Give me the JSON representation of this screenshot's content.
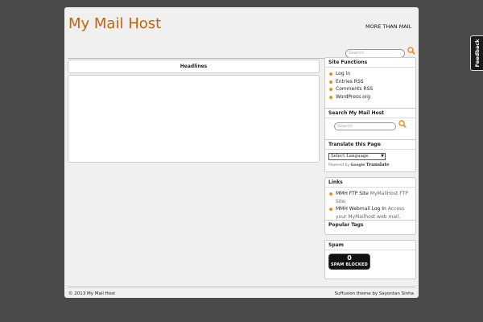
{
  "site": {
    "title": "My Mail Host",
    "tagline": "MORE THAN MAIL",
    "search_placeholder": "Search"
  },
  "main": {
    "headlines_label": "Headlines"
  },
  "sidebar": {
    "site_functions": {
      "title": "Site Functions",
      "items": [
        "Log in",
        "Entries RSS",
        "Comments RSS",
        "WordPress.org"
      ]
    },
    "search": {
      "title": "Search My Mail Host",
      "placeholder": "Search"
    },
    "translate": {
      "title": "Translate this Page",
      "select_value": "Select Language",
      "powered_by": "Powered by",
      "google": "Google",
      "translate_label": "Translate"
    },
    "links": {
      "title": "Links",
      "items": [
        {
          "name": "MMH FTP Site",
          "desc": "MyMailHost FTP Site."
        },
        {
          "name": "MMH Webmail Log In",
          "desc": "Access your MyMailhost web mail."
        }
      ]
    },
    "popular_tags": {
      "title": "Popular Tags"
    },
    "spam": {
      "title": "Spam",
      "count": "0",
      "label": "SPAM BLOCKED"
    }
  },
  "footer": {
    "copyright": "© 2013 My Mail Host",
    "credit": "Suffusion theme by Sayontan Sinha"
  },
  "feedback_label": "Feedback",
  "colors": {
    "accent": "#c8620a",
    "bullet": "#e8901c",
    "background": "#4a4a4a"
  }
}
